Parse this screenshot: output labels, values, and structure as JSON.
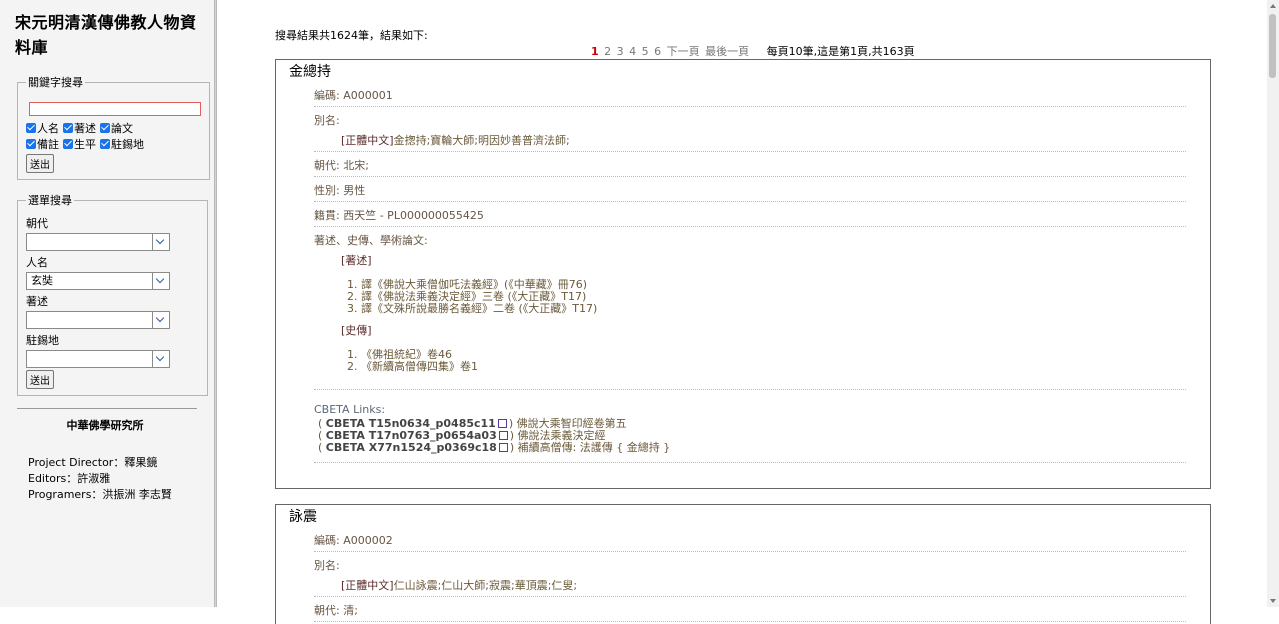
{
  "sidebar": {
    "title": "宋元明清漢傳佛教人物資料庫",
    "keyword": {
      "legend": "關鍵字搜尋",
      "value": "",
      "checkboxes": [
        "人名",
        "著述",
        "論文",
        "備註",
        "生平",
        "駐錫地"
      ],
      "submit": "送出"
    },
    "menu": {
      "legend": "選單搜尋",
      "fields": [
        {
          "label": "朝代",
          "value": ""
        },
        {
          "label": "人名",
          "value": "玄奘"
        },
        {
          "label": "著述",
          "value": ""
        },
        {
          "label": "駐錫地",
          "value": ""
        }
      ],
      "submit": "送出"
    },
    "institute": "中華佛學研究所",
    "credits": [
      "Project Director：釋果鏡",
      "Editors：許淑雅",
      "Programers：洪振洲 李志賢"
    ]
  },
  "main": {
    "summary": "搜尋結果共1624筆，結果如下:",
    "pager": {
      "pages": [
        "1",
        "2",
        "3",
        "4",
        "5",
        "6"
      ],
      "current": "1",
      "next": "下一頁",
      "last": "最後一頁",
      "info": "每頁10筆,這是第1頁,共163頁"
    },
    "records": [
      {
        "name": "金總持",
        "code_label": "編碼:",
        "code": "A000001",
        "alias_label": "別名:",
        "alias_tag": "[正體中文]",
        "alias": "金揔持;寶輪大師;明因妙善普濟法師;",
        "dynasty_label": "朝代:",
        "dynasty": "北宋;",
        "gender_label": "性別:",
        "gender": "男性",
        "origin_label": "籍貫:",
        "origin": "西天竺 - PL000000055425",
        "works_label": "著述、史傳、學術論文:",
        "works_tag": "[著述]",
        "works": [
          "譯《佛說大乘僧伽吒法義經》(《中華藏》冊76)",
          "譯《佛說法乘義決定經》三卷 (《大正藏》T17)",
          "譯《文殊所說最勝名義經》二卷 (《大正藏》T17)"
        ],
        "bio_tag": "[史傳]",
        "bios": [
          "《佛祖統紀》卷46",
          "《新續高僧傳四集》卷1"
        ],
        "cbeta_label": "CBETA Links:",
        "cbeta": [
          {
            "id": "CBETA T15n0634_p0485c11",
            "desc": ") 佛說大乘智印經卷第五"
          },
          {
            "id": "CBETA T17n0763_p0654a03",
            "desc": ") 佛說法乘義決定經"
          },
          {
            "id": "CBETA X77n1524_p0369c18",
            "desc": ") 補續高僧傳: 法護傳 { 金總持 }"
          }
        ]
      },
      {
        "name": "詠震",
        "code_label": "編碼:",
        "code": "A000002",
        "alias_label": "別名:",
        "alias_tag": "[正體中文]",
        "alias": "仁山詠震;仁山大師;寂震;華頂震;仁叟;",
        "dynasty_label": "朝代:",
        "dynasty": "清;"
      }
    ]
  }
}
